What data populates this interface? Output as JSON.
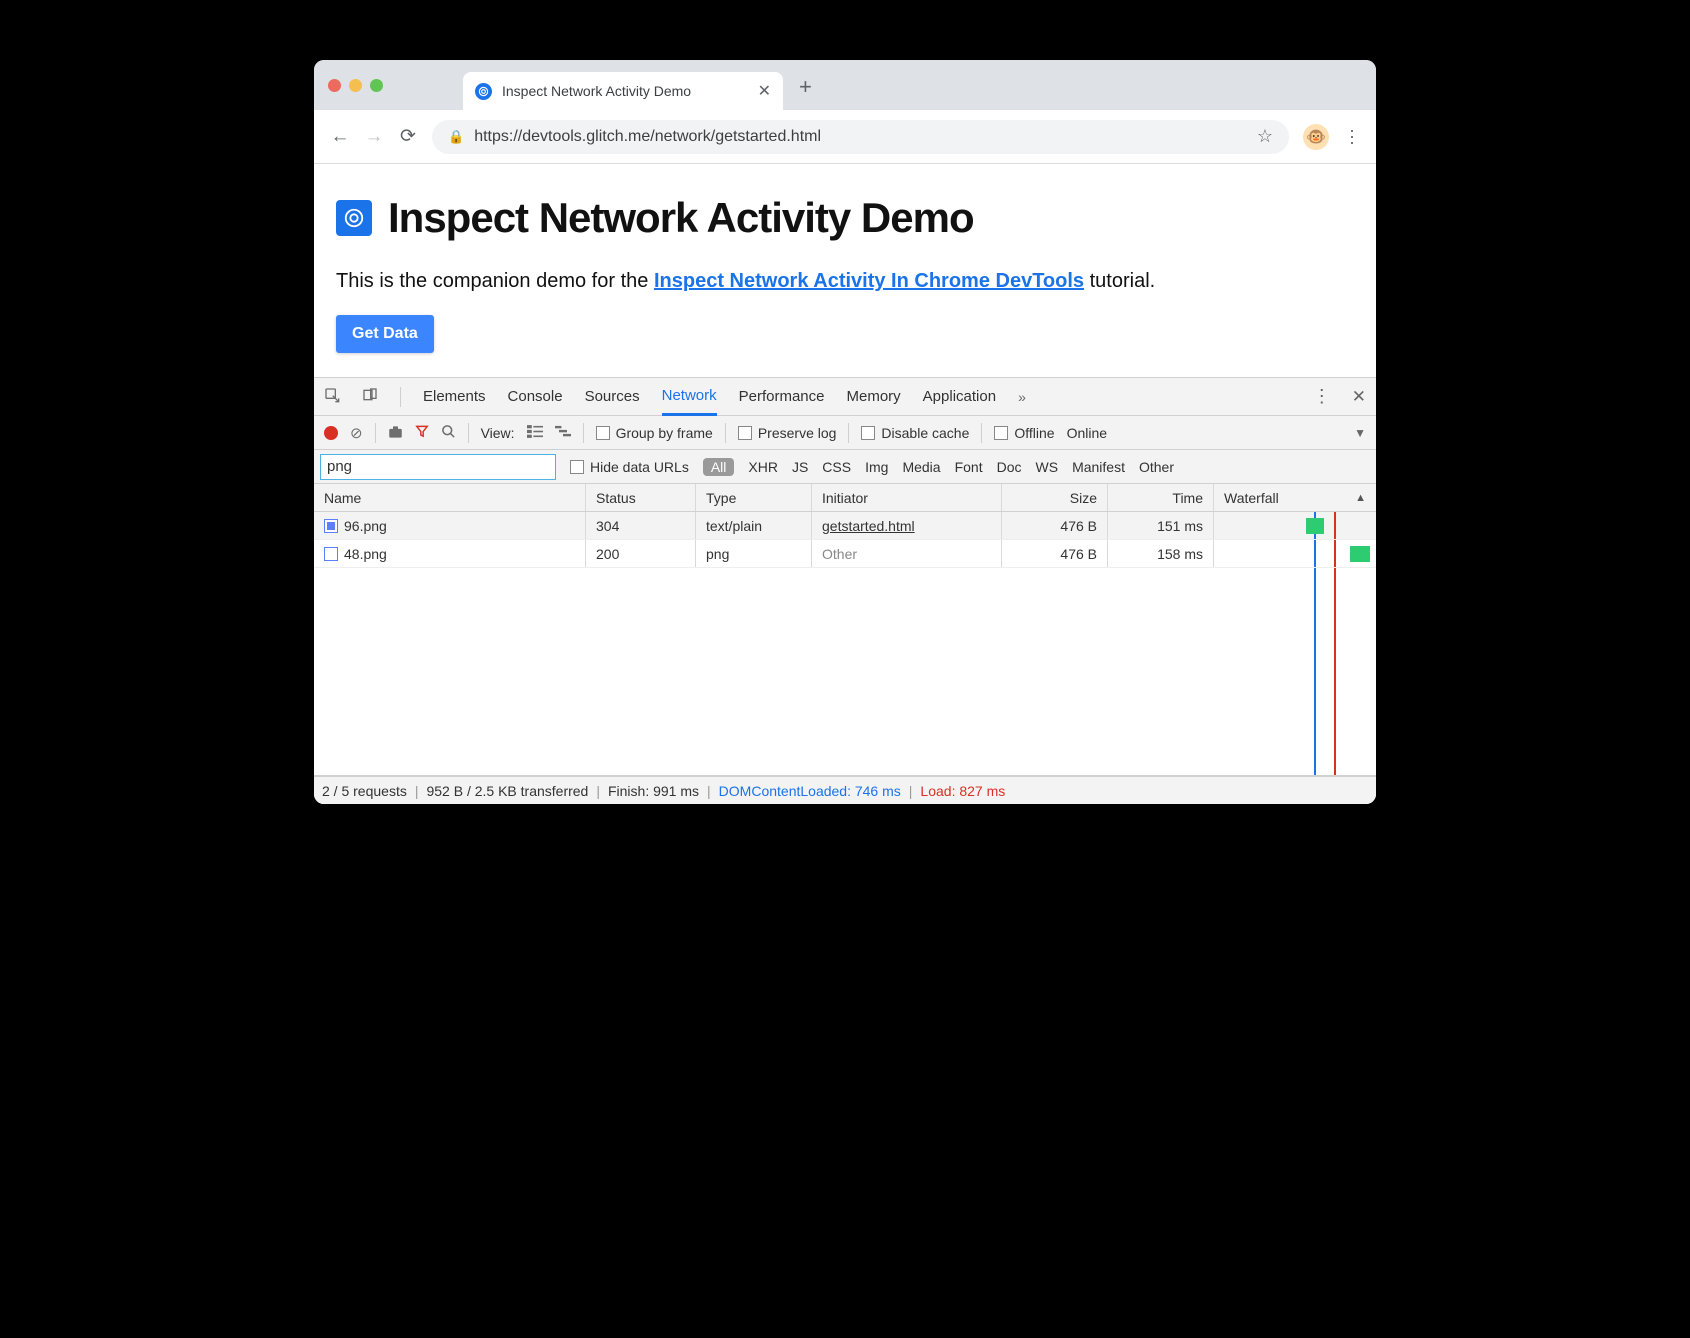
{
  "chrome": {
    "tab_title": "Inspect Network Activity Demo",
    "url": "https://devtools.glitch.me/network/getstarted.html",
    "avatar_emoji": "🐵"
  },
  "page": {
    "heading": "Inspect Network Activity Demo",
    "intro_pre": "This is the companion demo for the ",
    "intro_link": "Inspect Network Activity In Chrome DevTools",
    "intro_post": " tutorial.",
    "button": "Get Data"
  },
  "devtools": {
    "tabs": [
      "Elements",
      "Console",
      "Sources",
      "Network",
      "Performance",
      "Memory",
      "Application"
    ],
    "active_tab": "Network",
    "toolbar": {
      "view_label": "View:",
      "group": "Group by frame",
      "preserve": "Preserve log",
      "disable": "Disable cache",
      "offline": "Offline",
      "online": "Online"
    },
    "filter": {
      "value": "png",
      "hide": "Hide data URLs",
      "all": "All",
      "types": [
        "XHR",
        "JS",
        "CSS",
        "Img",
        "Media",
        "Font",
        "Doc",
        "WS",
        "Manifest",
        "Other"
      ]
    },
    "columns": [
      "Name",
      "Status",
      "Type",
      "Initiator",
      "Size",
      "Time",
      "Waterfall"
    ],
    "rows": [
      {
        "name": "96.png",
        "status": "304",
        "type": "text/plain",
        "initiator": "getstarted.html",
        "initiator_link": true,
        "size": "476 B",
        "time": "151 ms",
        "selected": true,
        "icon_filled": true
      },
      {
        "name": "48.png",
        "status": "200",
        "type": "png",
        "initiator": "Other",
        "initiator_link": false,
        "size": "476 B",
        "time": "158 ms",
        "selected": false,
        "icon_filled": false
      }
    ],
    "status": {
      "requests": "2 / 5 requests",
      "transfer": "952 B / 2.5 KB transferred",
      "finish": "Finish: 991 ms",
      "dcl": "DOMContentLoaded: 746 ms",
      "load": "Load: 827 ms"
    }
  }
}
